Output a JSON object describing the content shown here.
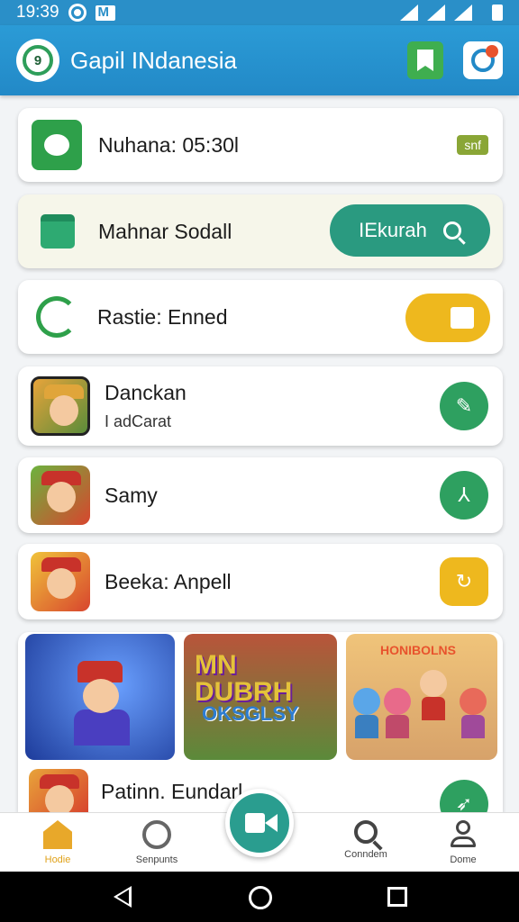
{
  "status_bar": {
    "time": "19:39"
  },
  "app_bar": {
    "title": "Gapil INdanesia",
    "logo_text": "9"
  },
  "cards": [
    {
      "label": "Nuhana: 05:30l",
      "badge": "snf"
    },
    {
      "label": "Mahnar Sodall",
      "button_label": "IEkurah"
    },
    {
      "label": "Rastie: Enned"
    },
    {
      "label": "Danckan",
      "sublabel": "I adCarat",
      "action_icon": "✎"
    },
    {
      "label": "Samy",
      "action_icon": "⅄"
    },
    {
      "label": "Beeka: Anpell",
      "action_icon": "↻"
    },
    {
      "label": "Patinn. Eundarl",
      "action_icon": "➶"
    }
  ],
  "gallery": {
    "g2_title_line1": "MN",
    "g2_title_line2": "DUBRH",
    "g2_sub": "OKSGLSY",
    "g3_header": "HONIBOLNS"
  },
  "bottom_nav": {
    "items": [
      {
        "label": "Hodie"
      },
      {
        "label": "Senpunts"
      },
      {
        "label": "Conndem"
      },
      {
        "label": "Dome"
      }
    ]
  },
  "colors": {
    "primary": "#2289c7",
    "accent_green": "#2ea060",
    "accent_yellow": "#eeb81e",
    "teal": "#2a9d8f"
  }
}
